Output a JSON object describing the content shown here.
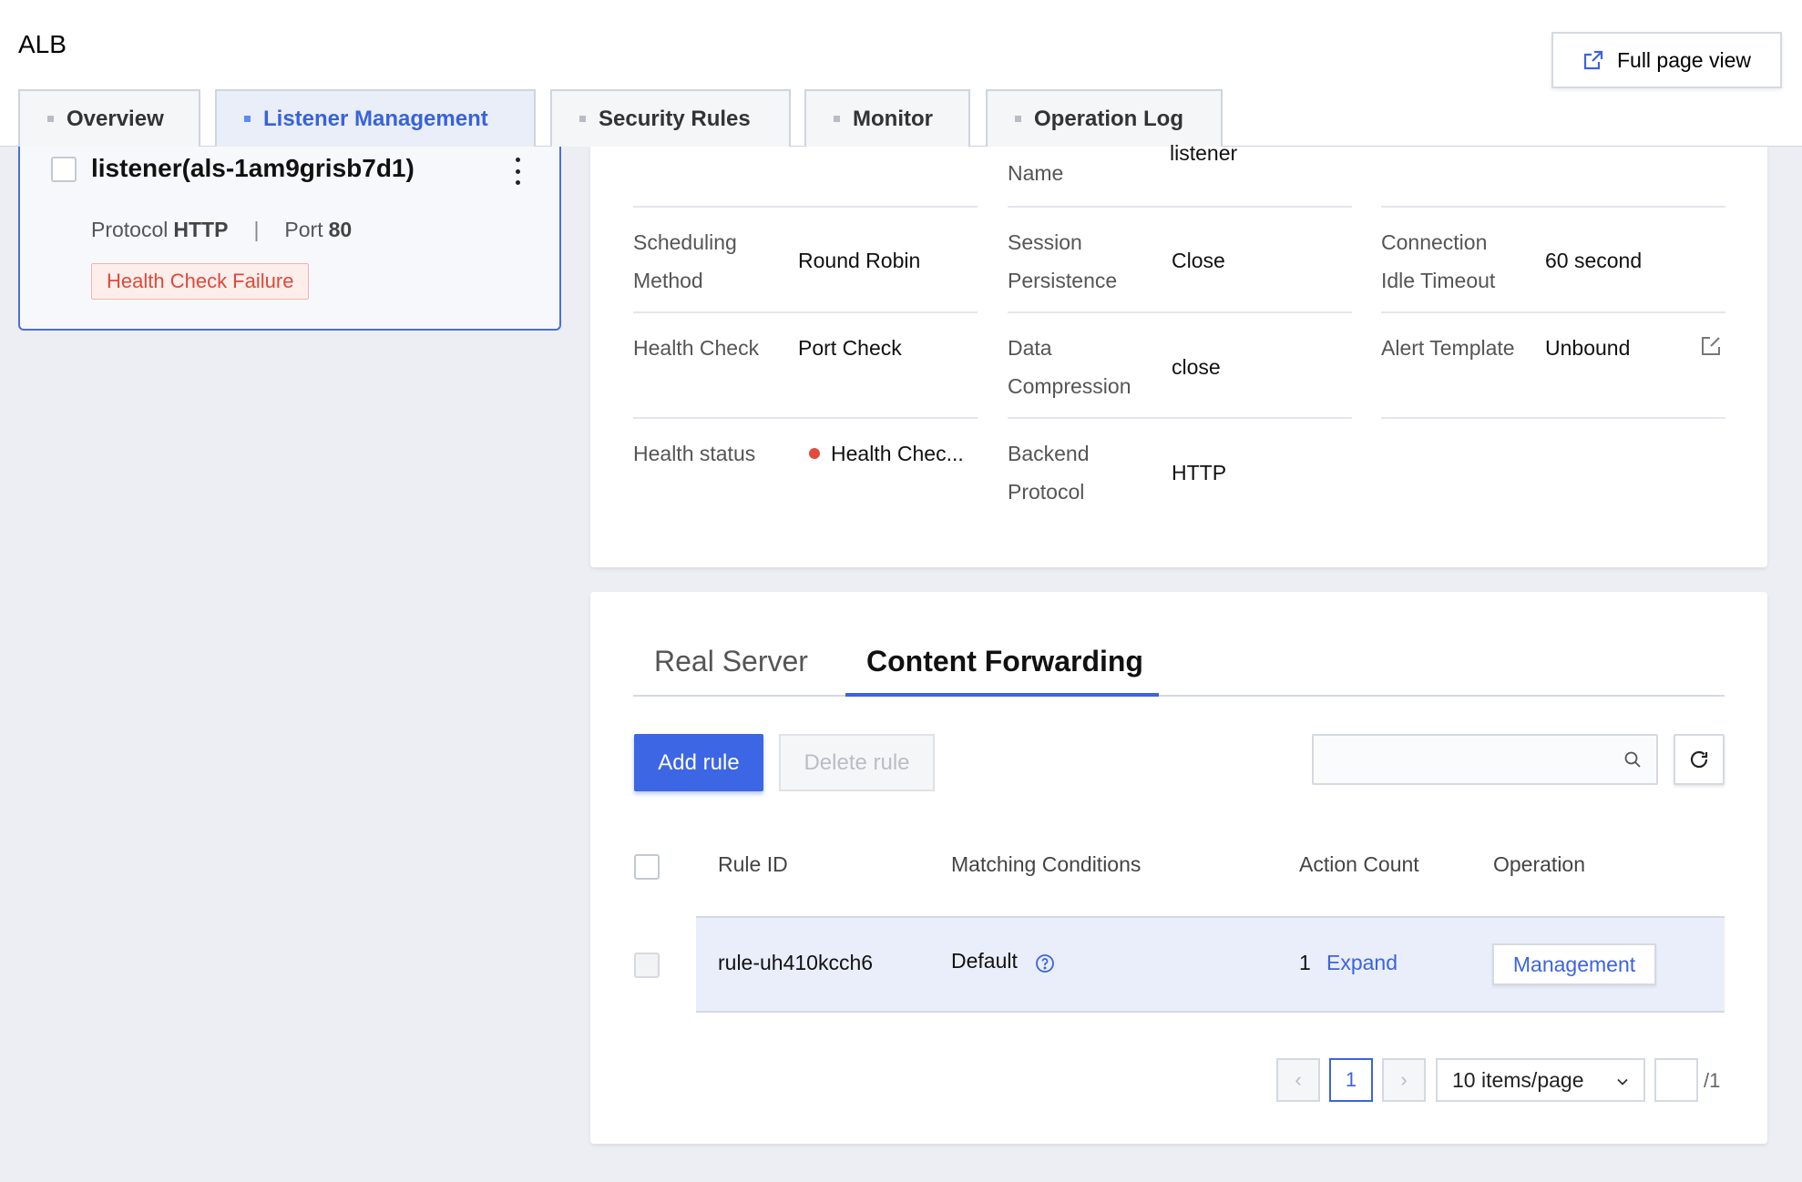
{
  "header": {
    "title": "ALB",
    "full_page_view_label": "Full page view",
    "tabs": [
      {
        "label": "Overview"
      },
      {
        "label": "Listener Management"
      },
      {
        "label": "Security Rules"
      },
      {
        "label": "Monitor"
      },
      {
        "label": "Operation Log"
      }
    ]
  },
  "listener": {
    "name": "listener(als-1am9grisb7d1)",
    "protocol_label": "Protocol",
    "protocol_value": "HTTP",
    "port_label": "Port",
    "port_value": "80",
    "separator": "|",
    "status_badge": "Health Check Failure"
  },
  "details": {
    "name_label": "Name",
    "name_value": "listener",
    "scheduling_label_1": "Scheduling",
    "scheduling_label_2": "Method",
    "scheduling_value": "Round Robin",
    "session_label_1": "Session",
    "session_label_2": "Persistence",
    "session_value": "Close",
    "idle_label_1": "Connection",
    "idle_label_2": "Idle Timeout",
    "idle_value": "60 second",
    "health_check_label": "Health Check",
    "health_check_value": "Port Check",
    "compression_label_1": "Data",
    "compression_label_2": "Compression",
    "compression_value": "close",
    "alert_label": "Alert Template",
    "alert_value": "Unbound",
    "health_status_label": "Health status",
    "health_status_value": "Health Chec...",
    "backend_label_1": "Backend",
    "backend_label_2": "Protocol",
    "backend_value": "HTTP"
  },
  "rules": {
    "tabs": [
      {
        "label": "Real Server"
      },
      {
        "label": "Content Forwarding"
      }
    ],
    "add_rule_label": "Add rule",
    "delete_rule_label": "Delete rule",
    "search_placeholder": "",
    "columns": [
      "Rule ID",
      "Matching Conditions",
      "Action Count",
      "Operation"
    ],
    "rows": [
      {
        "rule_id": "rule-uh410kcch6",
        "matching": "Default",
        "action_count": "1",
        "expand_label": "Expand",
        "operation_label": "Management"
      }
    ],
    "pagination": {
      "current_page": "1",
      "page_size_label": "10 items/page",
      "total_pages": "/1"
    }
  },
  "colors": {
    "accent": "#3d63de",
    "error": "#e0483a",
    "background": "#eceef3"
  }
}
